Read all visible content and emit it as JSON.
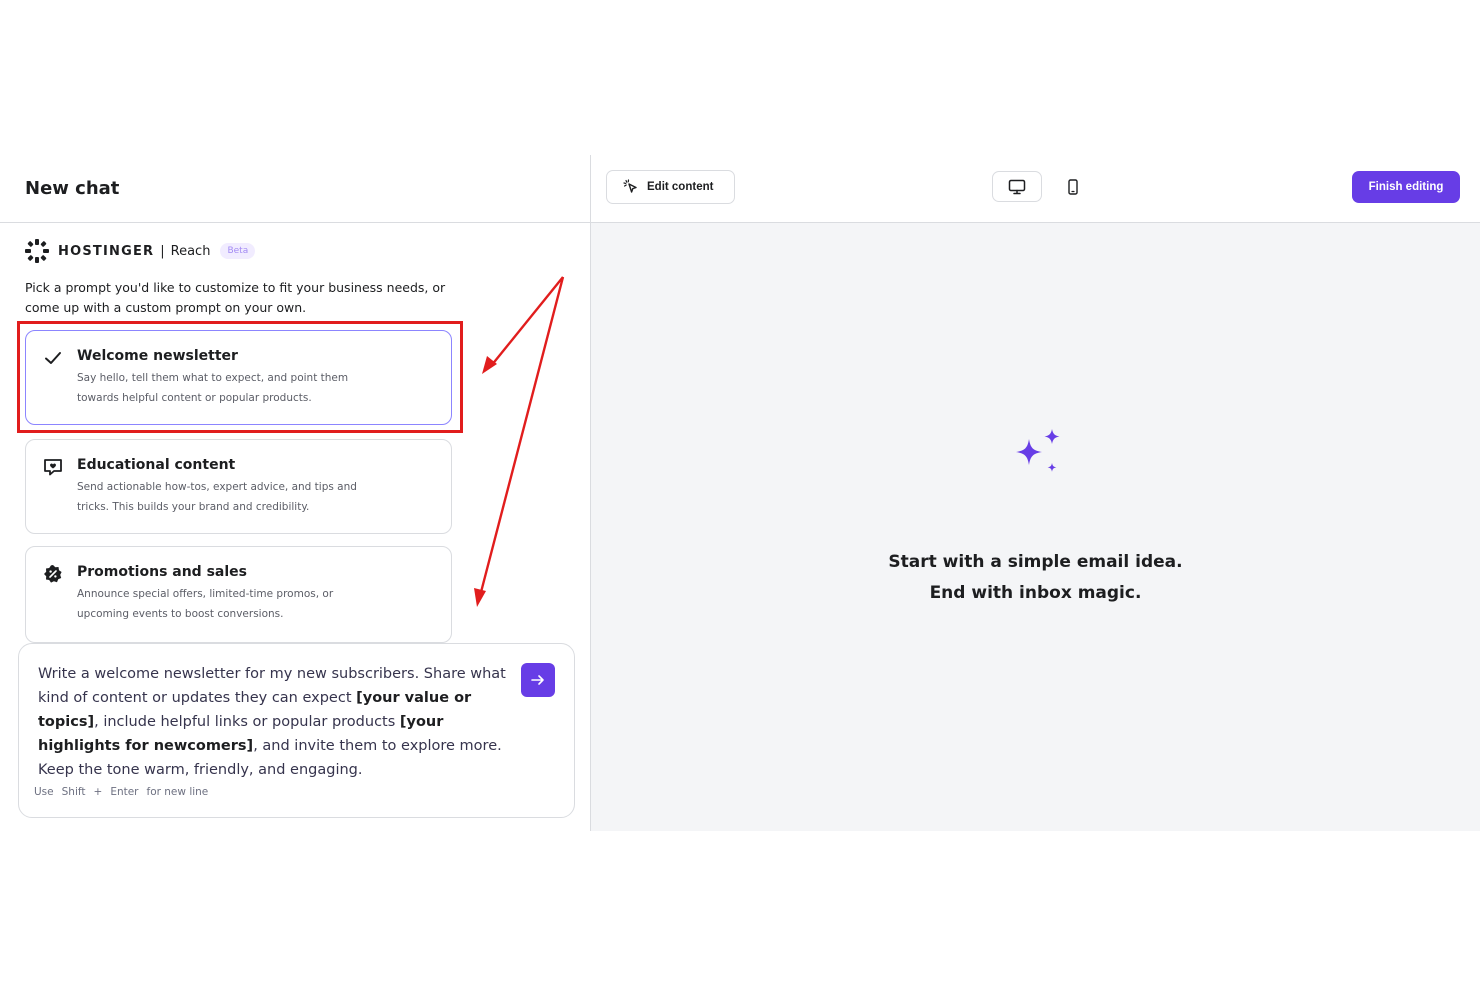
{
  "left_panel": {
    "title": "New chat",
    "brand": {
      "name": "HOSTINGER",
      "separator": "|",
      "product": "Reach",
      "badge": "Beta"
    },
    "intro": "Pick a prompt you'd like to customize to fit your business needs, or come up with a custom prompt on your own.",
    "prompts": [
      {
        "title": "Welcome newsletter",
        "description": "Say hello, tell them what to expect, and point them towards helpful content or popular products.",
        "icon": "check-icon",
        "selected": true
      },
      {
        "title": "Educational content",
        "description": "Send actionable how-tos, expert advice, and tips and tricks. This builds your brand and credibility.",
        "icon": "chat-bubble-icon",
        "selected": false
      },
      {
        "title": "Promotions and sales",
        "description": "Announce special offers, limited-time promos, or upcoming events to boost conversions.",
        "icon": "discount-badge-icon",
        "selected": false
      }
    ],
    "composer": {
      "segments": [
        {
          "text": "Write a welcome newsletter for my new subscribers. Share what kind of content or updates they can expect ",
          "bold": false
        },
        {
          "text": "[your value or topics]",
          "bold": true
        },
        {
          "text": ", include helpful links or popular products ",
          "bold": false
        },
        {
          "text": "[your highlights for newcomers]",
          "bold": true
        },
        {
          "text": ", and invite them to explore more. Keep the tone warm, friendly, and engaging.",
          "bold": false
        }
      ],
      "hint": {
        "use": "Use",
        "key1": "Shift",
        "plus": "+",
        "key2": "Enter",
        "suffix": "for new line"
      }
    }
  },
  "right_panel": {
    "edit_button": "Edit content",
    "finish_button": "Finish editing",
    "empty_state": {
      "line1": "Start with a simple email idea.",
      "line2": "End with inbox magic."
    }
  },
  "colors": {
    "accent": "#673de6",
    "annotation": "#e11d1d",
    "selected_border": "#8c85ff"
  }
}
